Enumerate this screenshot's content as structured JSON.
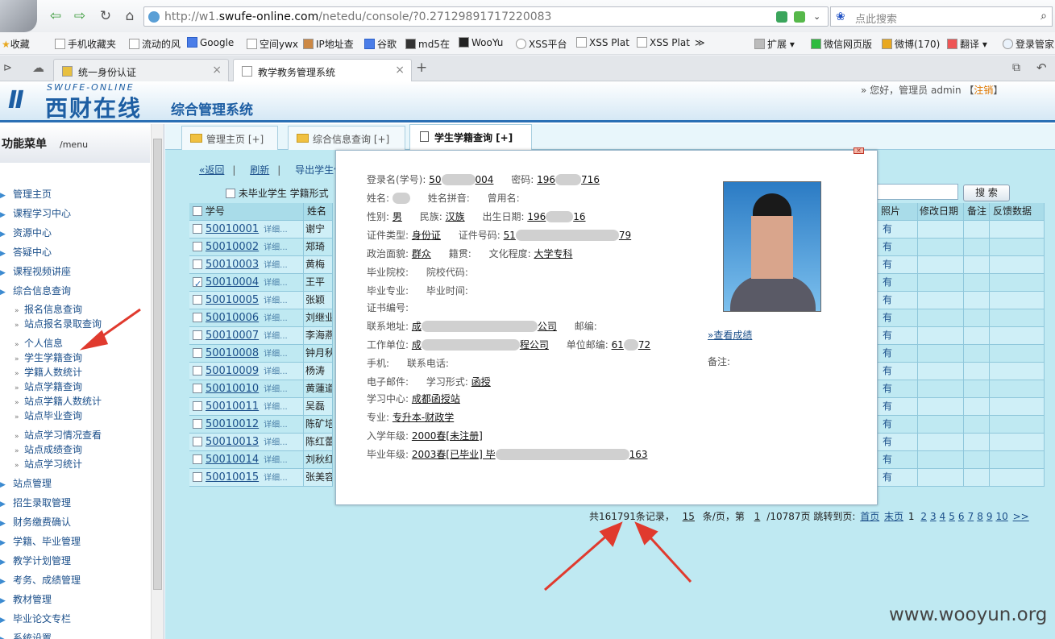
{
  "browser": {
    "url_prefix": "http://w1.",
    "url_domain": "swufe-online.com",
    "url_path": "/netedu/console/?0.27129891717220083",
    "search_placeholder": "点此搜索",
    "bookmarks": [
      "收藏",
      "手机收藏夹",
      "流动的风",
      "Google",
      "空间ywx",
      "IP地址查",
      "谷歌",
      "md5在",
      "WooYu",
      "XSS平台",
      "XSS Plat",
      "XSS Plat",
      "≫",
      "扩展",
      "微信网页版",
      "微博(170)",
      "翻译",
      "登录管家"
    ],
    "tabs": [
      {
        "title": "统一身份认证",
        "active": false
      },
      {
        "title": "教学教务管理系统",
        "active": true
      }
    ],
    "new_tab": "+"
  },
  "header": {
    "logo_en": "SWUFE-ONLINE",
    "logo_cn": "西财在线",
    "system_name": "综合管理系统",
    "greeting": "» 您好，管理员  admin 【",
    "logout": "注销",
    "greeting_end": "】"
  },
  "sidebar": {
    "title": "功能菜单",
    "subtitle": "/menu",
    "items": [
      {
        "label": "管理主页",
        "level": 1
      },
      {
        "label": "课程学习中心",
        "level": 1
      },
      {
        "label": "资源中心",
        "level": 1
      },
      {
        "label": "答疑中心",
        "level": 1
      },
      {
        "label": "课程视频讲座",
        "level": 1
      },
      {
        "label": "综合信息查询",
        "level": 1
      },
      {
        "label": "报名信息查询",
        "level": 2
      },
      {
        "label": "站点报名录取查询",
        "level": 2
      },
      {
        "label": "个人信息",
        "level": 2
      },
      {
        "label": "学生学籍查询",
        "level": 2
      },
      {
        "label": "学籍人数统计",
        "level": 2
      },
      {
        "label": "站点学籍查询",
        "level": 2
      },
      {
        "label": "站点学籍人数统计",
        "level": 2
      },
      {
        "label": "站点毕业查询",
        "level": 2
      },
      {
        "label": "站点学习情况查看",
        "level": 2
      },
      {
        "label": "站点成绩查询",
        "level": 2
      },
      {
        "label": "站点学习统计",
        "level": 2
      },
      {
        "label": "站点管理",
        "level": 1
      },
      {
        "label": "招生录取管理",
        "level": 1
      },
      {
        "label": "财务缴费确认",
        "level": 1
      },
      {
        "label": "学籍、毕业管理",
        "level": 1
      },
      {
        "label": "教学计划管理",
        "level": 1
      },
      {
        "label": "考务、成绩管理",
        "level": 1
      },
      {
        "label": "教材管理",
        "level": 1
      },
      {
        "label": "毕业论文专栏",
        "level": 1
      },
      {
        "label": "系统设置",
        "level": 1
      }
    ]
  },
  "page_tabs": [
    {
      "label": "管理主页 [+]",
      "active": false
    },
    {
      "label": "综合信息查询 [+]",
      "active": false
    },
    {
      "label": "学生学籍查询 [+]",
      "active": true
    }
  ],
  "toolbar": {
    "back": "«返回",
    "sep1": "|",
    "refresh": "刷新",
    "sep2": "|",
    "export": "导出学生信",
    "filter_label": "未毕业学生  学籍形式",
    "search_button": "搜 索"
  },
  "table": {
    "headers": {
      "id": "学号",
      "name": "姓名",
      "photo": "照片",
      "modified": "修改日期",
      "remark": "备注",
      "feedback": "反馈数据"
    },
    "detail_label": "详细...",
    "rows": [
      {
        "id": "50010001",
        "name": "谢宁",
        "photo": "有",
        "checked": false
      },
      {
        "id": "50010002",
        "name": "郑琦",
        "photo": "有",
        "checked": false
      },
      {
        "id": "50010003",
        "name": "黄梅",
        "photo": "有",
        "checked": false
      },
      {
        "id": "50010004",
        "name": "王平",
        "photo": "有",
        "checked": true
      },
      {
        "id": "50010005",
        "name": "张颖",
        "photo": "有",
        "checked": false
      },
      {
        "id": "50010006",
        "name": "刘继业",
        "photo": "有",
        "checked": false
      },
      {
        "id": "50010007",
        "name": "李海燕",
        "photo": "有",
        "checked": false
      },
      {
        "id": "50010008",
        "name": "钟月秋",
        "photo": "有",
        "checked": false
      },
      {
        "id": "50010009",
        "name": "杨涛",
        "photo": "有",
        "checked": false
      },
      {
        "id": "50010010",
        "name": "黄蓮道",
        "photo": "有",
        "checked": false
      },
      {
        "id": "50010011",
        "name": "吴磊",
        "photo": "有",
        "checked": false
      },
      {
        "id": "50010012",
        "name": "陈矿培",
        "photo": "有",
        "checked": false
      },
      {
        "id": "50010013",
        "name": "陈红蕾",
        "photo": "有",
        "checked": false
      },
      {
        "id": "50010014",
        "name": "刘秋红",
        "photo": "有",
        "checked": false
      },
      {
        "id": "50010015",
        "name": "张美容",
        "photo": "有",
        "checked": false
      }
    ]
  },
  "pager": {
    "total_prefix": "共",
    "total": "161791",
    "total_suffix": "条记录，",
    "per_page": "15",
    "per_page_suffix": "条/页，第",
    "current": "1",
    "pages": "/10787页 跳转到页:",
    "first": "首页",
    "last": "末页",
    "current_page": "1",
    "page_links": [
      "2",
      "3",
      "4",
      "5",
      "6",
      "7",
      "8",
      "9",
      "10"
    ],
    "next": ">>"
  },
  "popup": {
    "login_label": "登录名(学号):",
    "login_value": "50",
    "login_value_end": "004",
    "password_label": "密码:",
    "password_value": "196",
    "password_value_end": "716",
    "name_label": "姓名:",
    "pinyin_label": "姓名拼音:",
    "former_name_label": "曾用名:",
    "gender_label": "性别:",
    "gender_value": "男",
    "ethnic_label": "民族:",
    "ethnic_value": "汉族",
    "birth_label": "出生日期:",
    "birth_value": "196",
    "birth_value_end": "16",
    "cert_type_label": "证件类型:",
    "cert_type_value": "身份证",
    "cert_no_label": "证件号码:",
    "cert_no_value": "51",
    "cert_no_value_end": "79",
    "political_label": "政治面貌:",
    "political_value": "群众",
    "origin_label": "籍贯:",
    "education_label": "文化程度:",
    "education_value": "大学专科",
    "grad_school_label": "毕业院校:",
    "school_code_label": "院校代码:",
    "grad_major_label": "毕业专业:",
    "grad_time_label": "毕业时间:",
    "cert_number_label": "证书编号:",
    "address_label": "联系地址:",
    "address_value": "成",
    "address_value_end": "公司",
    "postcode_label": "邮编:",
    "work_label": "工作单位:",
    "work_value": "成",
    "work_value_end": "程公司",
    "work_post_label": "单位邮编:",
    "work_post_value": "61",
    "work_post_value_end": "72",
    "mobile_label": "手机:",
    "phone_label": "联系电话:",
    "email_label": "电子邮件:",
    "study_form_label": "学习形式:",
    "study_form_value": "函授",
    "center_label": "学习中心:",
    "center_value": "成都函授站",
    "major_label": "专业:",
    "major_value": "专升本-财政学",
    "entry_label": "入学年级:",
    "entry_value": "2000春[未注册]",
    "grad_year_label": "毕业年级:",
    "grad_year_value": "2003春[已毕业] 毕",
    "grad_year_value_end": "163",
    "score_link": "»查看成绩",
    "remark_label": "备注:"
  },
  "watermark": "www.wooyun.org"
}
